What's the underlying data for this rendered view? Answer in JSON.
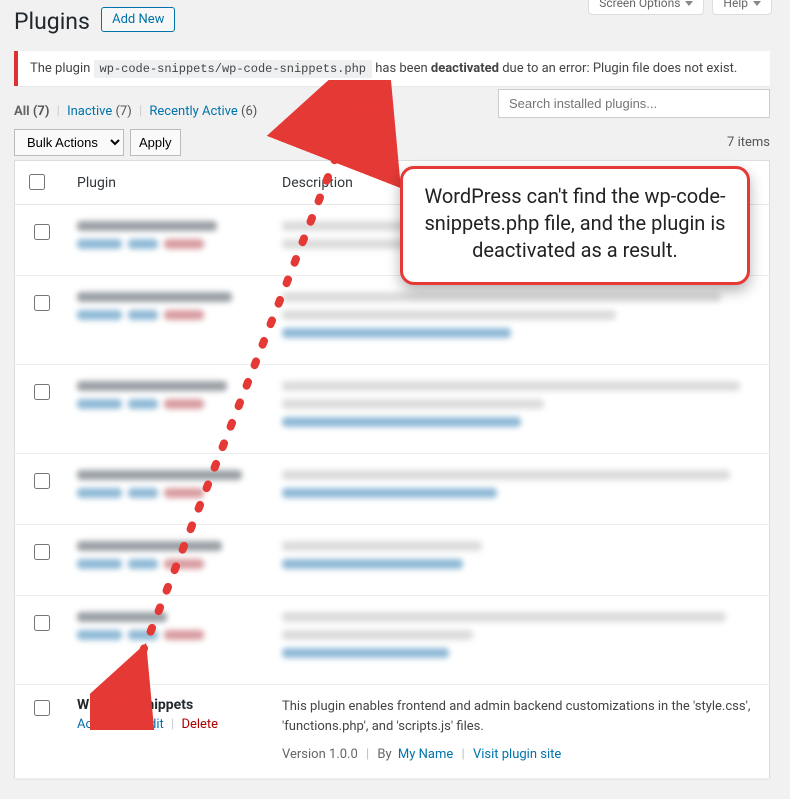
{
  "screen_top": {
    "screen_options": "Screen Options",
    "help": "Help"
  },
  "page_title": "Plugins",
  "add_new": "Add New",
  "notice": {
    "pre": "The plugin ",
    "code": "wp-code-snippets/wp-code-snippets.php",
    "mid": " has been ",
    "strong": "deactivated",
    "post": " due to an error: Plugin file does not exist."
  },
  "filters": {
    "all_label": "All",
    "all_count": "(7)",
    "inactive_label": "Inactive",
    "inactive_count": "(7)",
    "recent_label": "Recently Active",
    "recent_count": "(6)"
  },
  "search_placeholder": "Search installed plugins...",
  "bulk": {
    "select_label": "Bulk Actions",
    "apply_label": "Apply"
  },
  "items_count": "7 items",
  "columns": {
    "plugin": "Plugin",
    "description": "Description"
  },
  "visible_plugin": {
    "name": "WP Code Snippets",
    "activate": "Activate",
    "edit": "Edit",
    "delete": "Delete",
    "description": "This plugin enables frontend and admin backend customizations in the 'style.css', 'functions.php', and 'scripts.js' files.",
    "version_prefix": "Version 1.0.0",
    "by": "By",
    "author": "My Name",
    "visit": "Visit plugin site"
  },
  "callout_text": "WordPress can't find the wp-code-snippets.php file, and the plugin is deactivated as a result."
}
